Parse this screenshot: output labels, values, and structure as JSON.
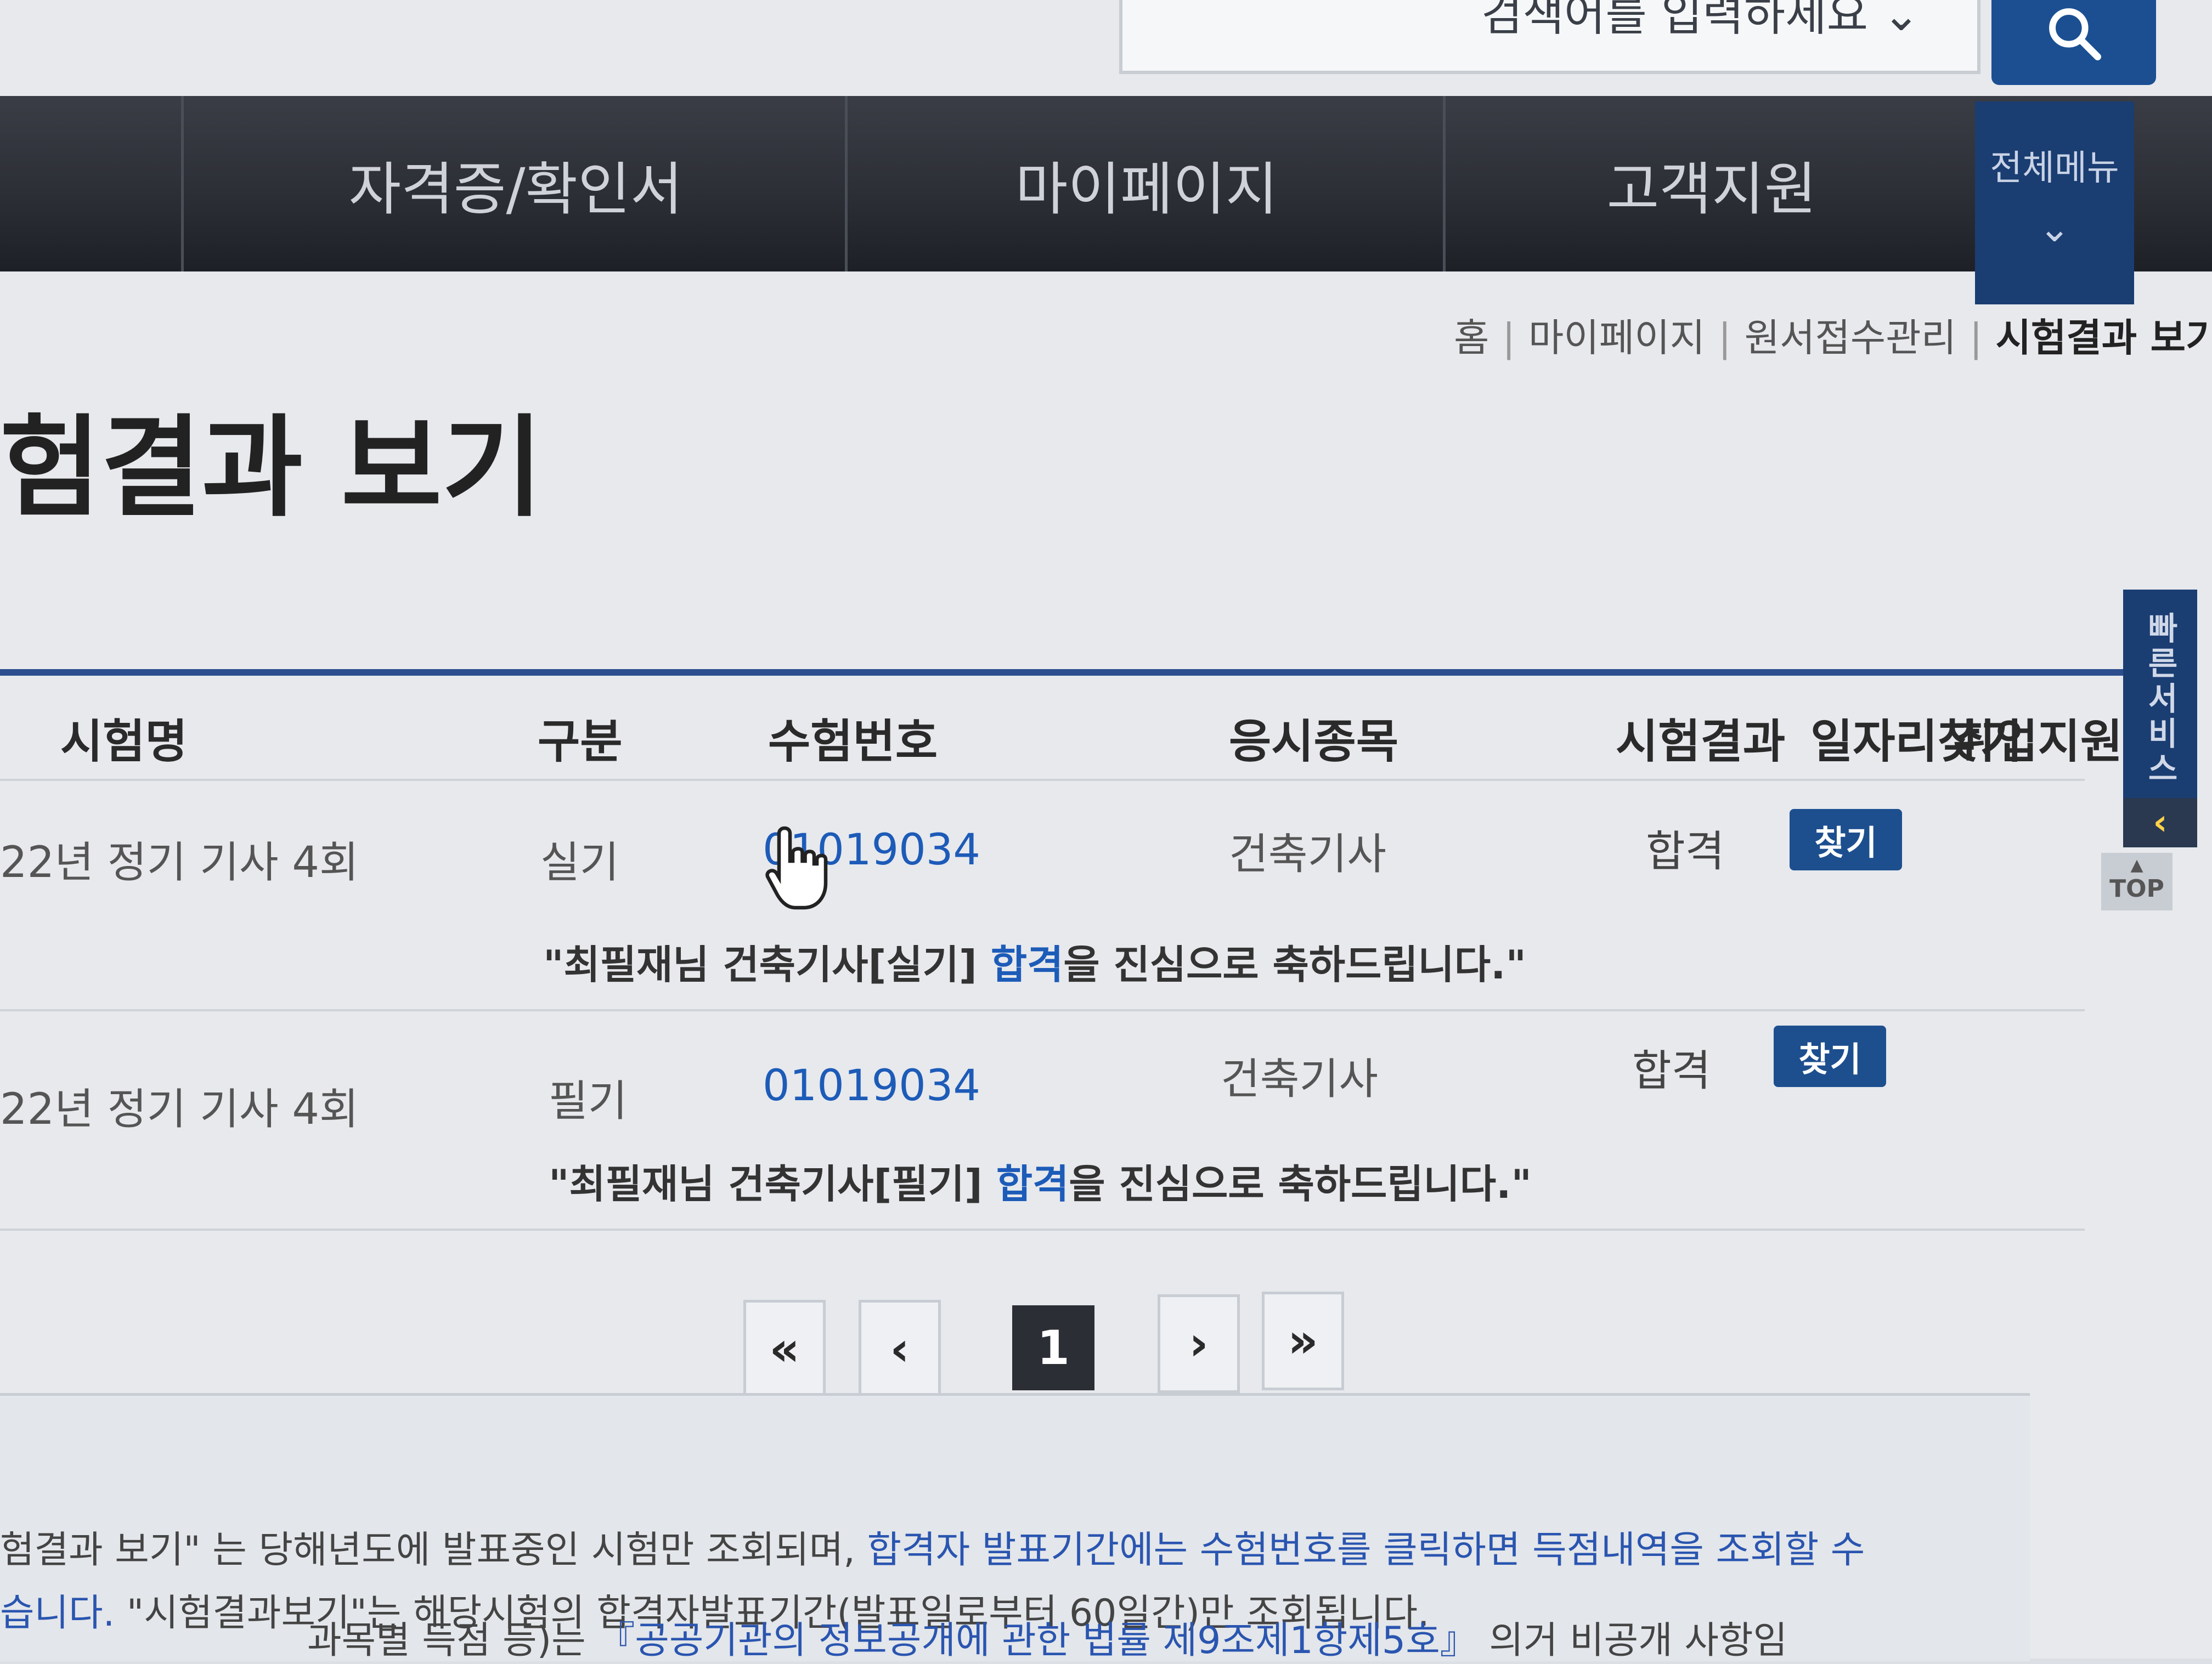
{
  "search": {
    "text": "검색어를 입력하세요 ⌄"
  },
  "nav": {
    "items": [
      "자격증/확인서",
      "마이페이지",
      "고객지원"
    ],
    "all_menu": "전체메뉴",
    "all_menu_icon": "⌄"
  },
  "breadcrumb": {
    "items": [
      "홈",
      "마이페이지",
      "원서접수관리",
      "시험결과 보기"
    ],
    "separator": "|"
  },
  "page_title": "험결과 보기",
  "table": {
    "headers": [
      "시험명",
      "구분",
      "수험번호",
      "응시종목",
      "시험결과",
      "일자리찾기",
      "취업지원"
    ],
    "rows": [
      {
        "exam": "22년 정기 기사 4회",
        "type": "실기",
        "number": "01019034",
        "subject": "건축기사",
        "result": "합격",
        "button": "찾기",
        "message_prefix": "\"최필재님 건축기사[실기] ",
        "message_highlight": "합격",
        "message_suffix": "을 진심으로 축하드립니다.\""
      },
      {
        "exam": "22년 정기 기사 4회",
        "type": "필기",
        "number": "01019034",
        "subject": "건축기사",
        "result": "합격",
        "button": "찾기",
        "message_prefix": "\"최필재님 건축기사[필기] ",
        "message_highlight": "합격",
        "message_suffix": "을 진심으로 축하드립니다.\""
      }
    ]
  },
  "pagination": {
    "first": "«",
    "prev": "‹",
    "current": "1",
    "next": "›",
    "last": "»"
  },
  "notes": {
    "line1_prefix": "합격자 발표기간에는 수험번호를 클릭하면 득점내역을 조회할 수",
    "line2_a": "험결과 보기\" 는 당해년도에 발표중인 시험만 조회되며, ",
    "line2_b": "합격자 발표기간에는 수험번호를 클릭하면 득점내역을 조회할 수",
    "line3": "\"시험결과보기\"는 해당시험의 합격자발표기간(발표일로부터 60일간)만 조회됩니다.",
    "line4_a": "습니다. ",
    "line4_b": "\"시험결과보기\"는 해당시험의 합격자발표기간(발표일로부터 60일간)만 조회됩니다.",
    "line5_a": "『공공기관의 정보공개에 관한 법률 제9조제1항제5호』",
    "line5_b": " 의거 비공개 사항임",
    "line6": "과목별 득점 등)는 "
  },
  "side": {
    "quick_service": "빠른서비스",
    "arrow": "‹",
    "top_arrow": "▲",
    "top": "TOP"
  },
  "colors": {
    "nav_bg": "#2c2f36",
    "accent": "#1d4f8f",
    "link": "#1d5bb8"
  }
}
